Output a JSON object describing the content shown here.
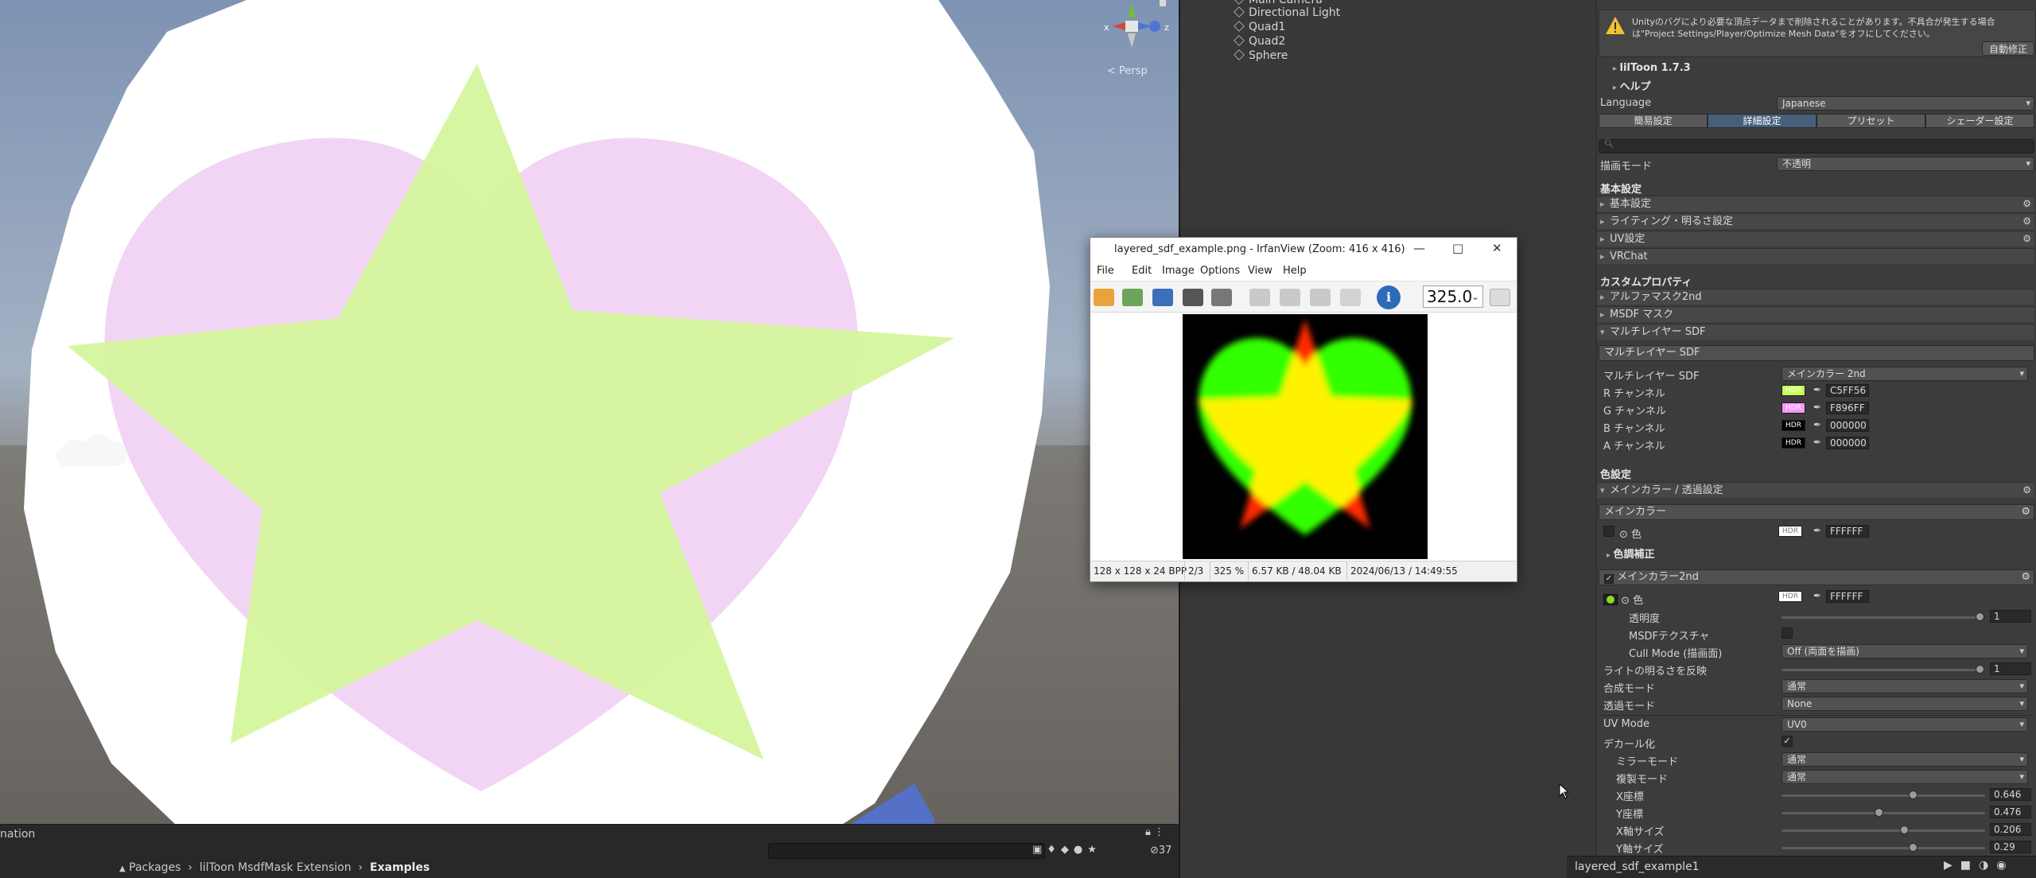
{
  "scene": {
    "view_mode": "< Persp",
    "axis_x": "x",
    "axis_z": "z",
    "search_placeholder": "",
    "result_count": "37",
    "tab_label": "nation"
  },
  "breadcrumb": [
    "Packages",
    "lilToon MsdfMask Extension",
    "Examples"
  ],
  "hierarchy": {
    "items": [
      "Main Camera",
      "Directional Light",
      "Quad1",
      "Quad2",
      "Sphere"
    ]
  },
  "inspector": {
    "warning": "Unityのバグにより必要な頂点データまで削除されることがあります。不具合が発生する場合は\"Project Settings/Player/Optimize Mesh Data\"をオフにしてください。",
    "auto_fix": "自動修正",
    "version": "lilToon 1.7.3",
    "help": "ヘルプ",
    "language_label": "Language",
    "language_value": "Japanese",
    "tabs": [
      "簡易設定",
      "詳細設定",
      "プリセット",
      "シェーダー設定"
    ],
    "render_mode_label": "描画モード",
    "render_mode_value": "不透明",
    "basic_header": "基本設定",
    "basic_folds": [
      "基本設定",
      "ライティング・明るさ設定",
      "UV設定",
      "VRChat"
    ],
    "custom_header": "カスタムプロパティ",
    "custom_folds": [
      "アルファマスク2nd",
      "MSDF マスク",
      "マルチレイヤー SDF"
    ],
    "sdf": {
      "header": "マルチレイヤー SDF",
      "target_label": "マルチレイヤー SDF",
      "target_value": "メインカラー 2nd",
      "channels": [
        {
          "label": "R チャンネル",
          "hex": "C5FF56",
          "color": "#c5ff56"
        },
        {
          "label": "G チャンネル",
          "hex": "F896FF",
          "color": "#f896ff"
        },
        {
          "label": "B チャンネル",
          "hex": "000000",
          "color": "#000000"
        },
        {
          "label": "A チャンネル",
          "hex": "000000",
          "color": "#000000"
        }
      ],
      "hdr": "HDR"
    },
    "color_header": "色設定",
    "main_color_fold": "メインカラー / 透過設定",
    "main_color": {
      "header": "メインカラー",
      "color_label": "色",
      "hex": "FFFFFF",
      "tone_fold": "色調補正"
    },
    "main2": {
      "header": "メインカラー2nd",
      "color_label": "色",
      "hex": "FFFFFF",
      "opacity_label": "透明度",
      "opacity_value": "1",
      "msdf_label": "MSDFテクスチャ",
      "cull_label": "Cull Mode (描画面)",
      "cull_value": "Off (両面を描画)",
      "lightinv_label": "ライトの明るさを反映",
      "lightinv_value": "1",
      "blend_label": "合成モード",
      "blend_value": "通常",
      "transp_label": "透過モード",
      "transp_value": "None",
      "uv_label": "UV Mode",
      "uv_value": "UV0",
      "decal_label": "デカール化",
      "mirror_label": "ミラーモード",
      "mirror_value": "通常",
      "copy_label": "複製モード",
      "copy_value": "通常",
      "sliders": [
        {
          "label": "X座標",
          "value": "0.646",
          "fraction": 0.646
        },
        {
          "label": "Y座標",
          "value": "0.476",
          "fraction": 0.476
        },
        {
          "label": "X軸サイズ",
          "value": "0.206",
          "fraction": 0.603
        },
        {
          "label": "Y軸サイズ",
          "value": "0.29",
          "fraction": 0.646
        }
      ]
    },
    "footer_title": "layered_sdf_example1"
  },
  "irfanview": {
    "title": "layered_sdf_example.png - IrfanView (Zoom: 416 x 416)",
    "menu": [
      "File",
      "Edit",
      "Image",
      "Options",
      "View",
      "Help"
    ],
    "zoom_value": "325.0",
    "status": [
      "128 x 128 x 24 BPP",
      "2/3",
      "325 %",
      "6.57 KB / 48.04 KB",
      "2024/06/13 / 14:49:55"
    ]
  },
  "colors": {
    "star_green": "#d6f3a0",
    "heart_pink": "#f2d4f4",
    "sphere": "#ffffff"
  }
}
